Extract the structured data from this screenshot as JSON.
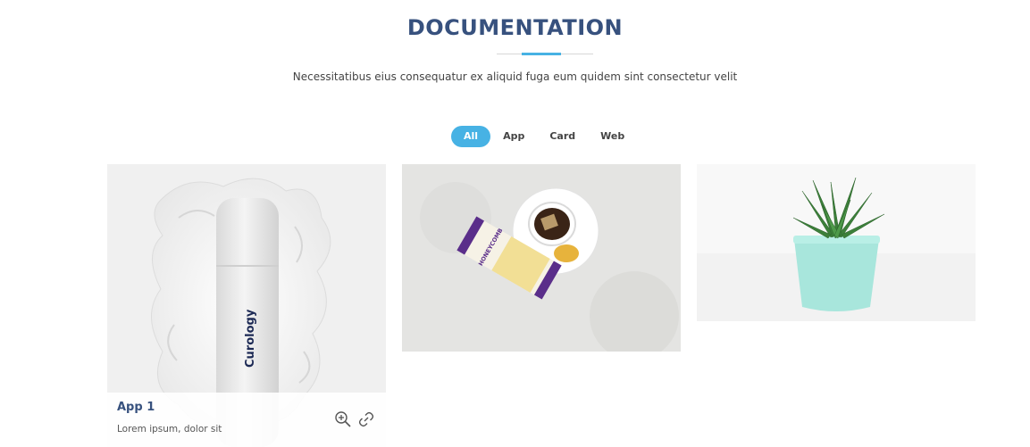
{
  "section": {
    "title": "DOCUMENTATION",
    "subtitle": "Necessitatibus eius consequatur ex aliquid fuga eum quidem sint consectetur velit"
  },
  "filters": [
    {
      "label": "All",
      "active": true
    },
    {
      "label": "App",
      "active": false
    },
    {
      "label": "Card",
      "active": false
    },
    {
      "label": "Web",
      "active": false
    }
  ],
  "items": [
    {
      "image": "lotion-bottle-photo",
      "product_label": "Curology",
      "title": "App 1",
      "description": "Lorem ipsum, dolor sit",
      "icons": [
        "zoom-in-icon",
        "link-icon"
      ]
    },
    {
      "image": "tea-and-honey-photo",
      "product_label": "HONEYCOMB"
    },
    {
      "image": "succulent-pot-photo"
    }
  ],
  "colors": {
    "heading": "#37517e",
    "accent": "#47b2e4",
    "text": "#444444"
  }
}
